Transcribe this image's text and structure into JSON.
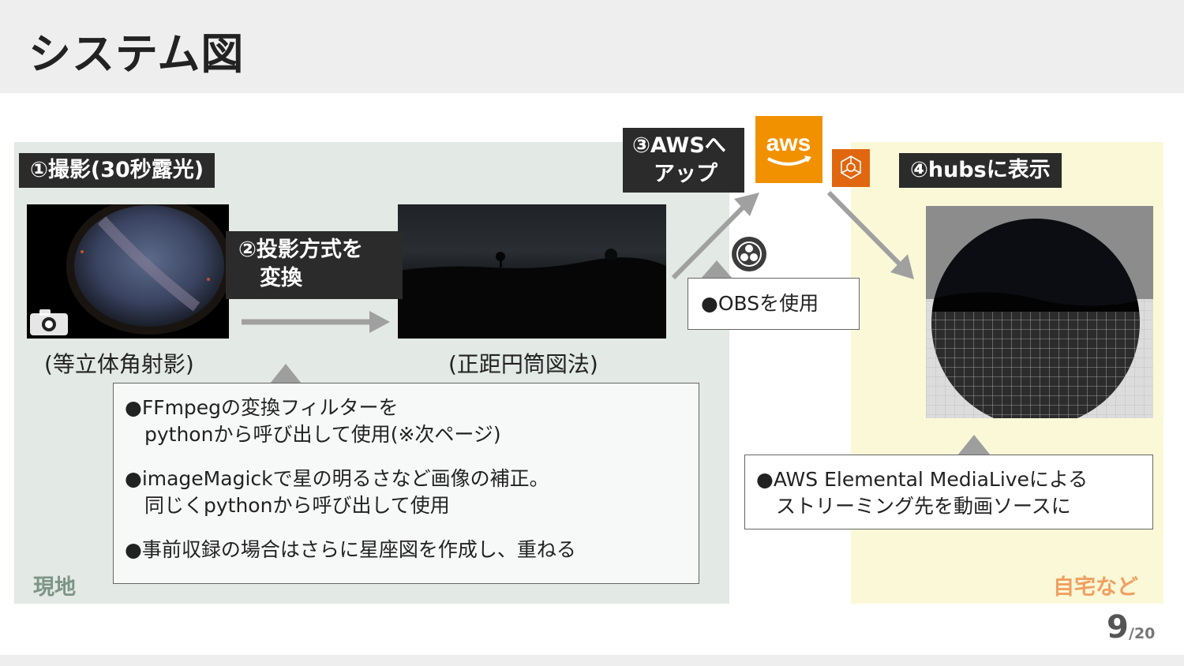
{
  "title": "システム図",
  "zones": {
    "site": "現地",
    "home": "自宅など"
  },
  "steps": {
    "step1": "①撮影(30秒露光)",
    "step2": "②投影方式を\n　変換",
    "step3": "③AWSへ\n　アップ",
    "step4": "④hubsに表示"
  },
  "captions": {
    "fisheye": "(等立体角射影)",
    "panorama": "(正距円筒図法)"
  },
  "notes": {
    "main": [
      "●FFmpegの変換フィルターを",
      "　pythonから呼び出して使用(※次ページ)",
      "●imageMagickで星の明るさなど画像の補正。",
      "　同じくpythonから呼び出して使用",
      "●事前収録の場合はさらに星座図を作成し、重ねる"
    ],
    "obs": "●OBSを使用",
    "aws": [
      "●AWS Elemental MediaLiveによる",
      "　ストリーミング先を動画ソースに"
    ]
  },
  "aws_logo_text": "aws",
  "icons": {
    "camera": "camera-icon",
    "obs": "obs-icon",
    "aws": "aws-logo",
    "medialive": "medialive-icon",
    "arrows": "arrow-icon"
  },
  "colors": {
    "tag_bg": "#2b2b2b",
    "site_bg": "#e3e9e5",
    "home_bg": "#fbf8d8",
    "site_label": "#7d9487",
    "home_label": "#f0a060",
    "aws_orange": "#f29100",
    "arrow": "#a0a0a0"
  },
  "page": {
    "current": "9",
    "total": "/20"
  }
}
